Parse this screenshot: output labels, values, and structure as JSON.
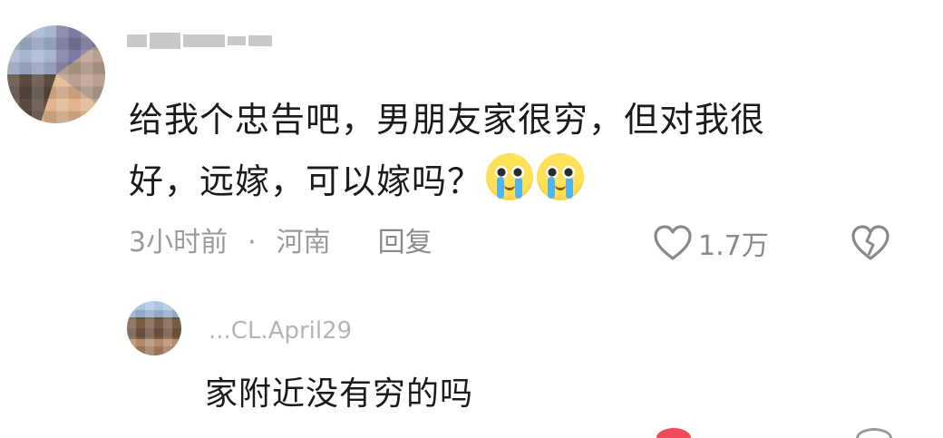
{
  "main_comment": {
    "username": "",
    "text_line1": "给我个忠告吧，男朋友家很穷，但对我很",
    "text_line2": "好，远嫁，可以嫁吗？",
    "emojis": [
      "crying-face",
      "crying-face"
    ],
    "time": "3小时前",
    "separator": "·",
    "location": "河南",
    "reply_label": "回复",
    "likes": "1.7万"
  },
  "reply_comment": {
    "username": "...CL.April29",
    "text": "家附近没有穷的吗"
  },
  "colors": {
    "text": "#1b1b1b",
    "meta": "#9a9a9a",
    "background": "#ffffff"
  }
}
